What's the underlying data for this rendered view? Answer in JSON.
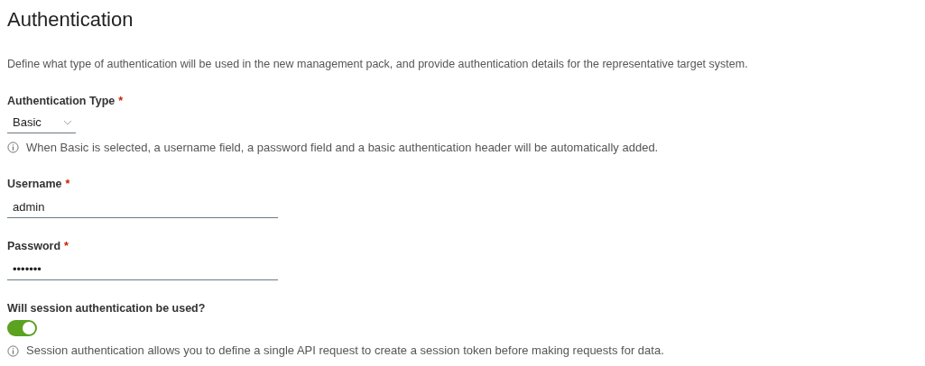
{
  "title": "Authentication",
  "description": "Define what type of authentication will be used in the new management pack, and provide authentication details for the representative target system.",
  "fields": [
    {
      "kind": "select",
      "label": "Authentication Type",
      "required_mark": "*",
      "value": "Basic",
      "help": "When Basic is selected, a username field, a password field and a basic authentication header will be automatically added."
    },
    {
      "kind": "text",
      "label": "Username",
      "required_mark": "*",
      "value": "admin"
    },
    {
      "kind": "text",
      "label": "Password",
      "required_mark": "*",
      "value": "•••••••"
    },
    {
      "kind": "toggle",
      "label": "Will session authentication be used?",
      "on": true,
      "help": "Session authentication allows you to define a single API request to create a session token before making requests for data."
    }
  ]
}
